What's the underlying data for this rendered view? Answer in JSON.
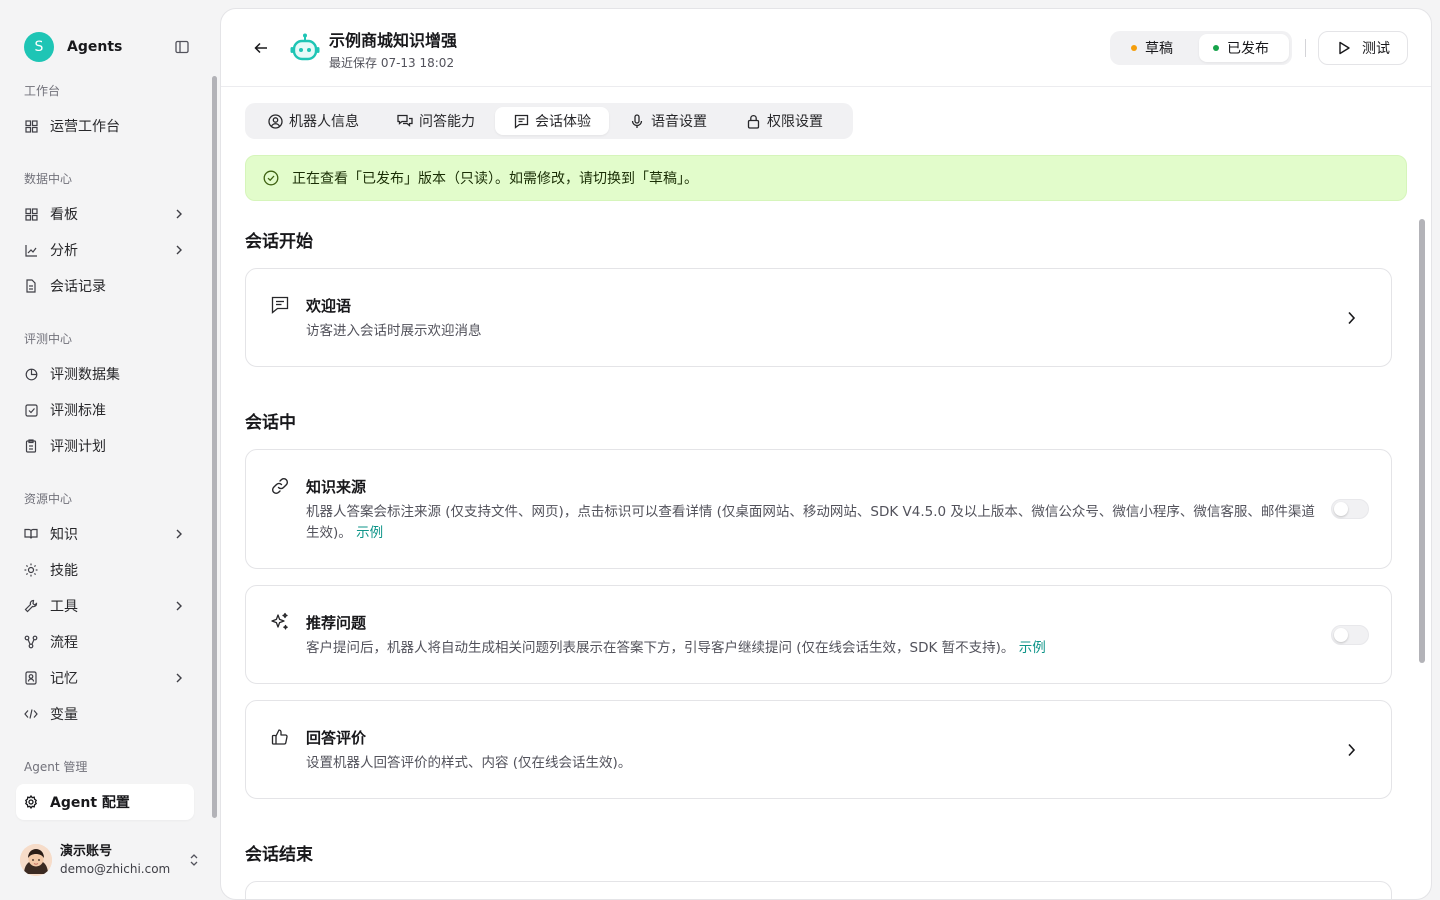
{
  "brand": {
    "logo_letter": "S",
    "name": "Agents"
  },
  "sidebar": {
    "groups": [
      {
        "label": "工作台",
        "items": [
          {
            "label": "运营工作台",
            "icon": "dashboard-icon",
            "chevron": false
          }
        ]
      },
      {
        "label": "数据中心",
        "items": [
          {
            "label": "看板",
            "icon": "board-icon",
            "chevron": true
          },
          {
            "label": "分析",
            "icon": "chart-line-icon",
            "chevron": true
          },
          {
            "label": "会话记录",
            "icon": "file-text-icon",
            "chevron": false
          }
        ]
      },
      {
        "label": "评测中心",
        "items": [
          {
            "label": "评测数据集",
            "icon": "pie-chart-icon",
            "chevron": false
          },
          {
            "label": "评测标准",
            "icon": "check-square-icon",
            "chevron": false
          },
          {
            "label": "评测计划",
            "icon": "clipboard-icon",
            "chevron": false
          }
        ]
      },
      {
        "label": "资源中心",
        "items": [
          {
            "label": "知识",
            "icon": "book-icon",
            "chevron": true
          },
          {
            "label": "技能",
            "icon": "sun-icon",
            "chevron": false
          },
          {
            "label": "工具",
            "icon": "wrench-icon",
            "chevron": true
          },
          {
            "label": "流程",
            "icon": "workflow-icon",
            "chevron": false
          },
          {
            "label": "记忆",
            "icon": "memory-icon",
            "chevron": true
          },
          {
            "label": "变量",
            "icon": "code-icon",
            "chevron": false
          }
        ]
      },
      {
        "label": "Agent 管理",
        "items": [
          {
            "label": "Agent 配置",
            "icon": "gear-icon",
            "chevron": false,
            "active": true
          }
        ]
      }
    ]
  },
  "user": {
    "name": "演示账号",
    "email": "demo@zhichi.com"
  },
  "header": {
    "title": "示例商城知识增强",
    "saved": "最近保存 07-13 18:02",
    "version_draft": "草稿",
    "version_published": "已发布",
    "test_label": "测试"
  },
  "tabs": [
    {
      "label": "机器人信息",
      "icon": "user-circle-icon"
    },
    {
      "label": "问答能力",
      "icon": "chat-bubbles-icon"
    },
    {
      "label": "会话体验",
      "icon": "message-square-icon",
      "active": true
    },
    {
      "label": "语音设置",
      "icon": "microphone-icon"
    },
    {
      "label": "权限设置",
      "icon": "lock-icon"
    }
  ],
  "notice": "正在查看「已发布」版本（只读）。如需修改，请切换到「草稿」。",
  "sections": {
    "start": "会话开始",
    "during": "会话中",
    "end": "会话结束"
  },
  "cards": {
    "welcome": {
      "title": "欢迎语",
      "desc": "访客进入会话时展示欢迎消息"
    },
    "source": {
      "title": "知识来源",
      "desc": "机器人答案会标注来源 (仅支持文件、网页)，点击标识可以查看详情 (仅桌面网站、移动网站、SDK V4.5.0 及以上版本、微信公众号、微信小程序、微信客服、邮件渠道生效)。",
      "link": "示例",
      "enabled": false
    },
    "suggest": {
      "title": "推荐问题",
      "desc": "客户提问后，机器人将自动生成相关问题列表展示在答案下方，引导客户继续提问 (仅在线会话生效，SDK 暂不支持)。",
      "link": "示例",
      "enabled": false
    },
    "rating": {
      "title": "回答评价",
      "desc": "设置机器人回答评价的样式、内容 (仅在线会话生效)。"
    }
  },
  "colors": {
    "accent": "#1ec5b5",
    "link": "#0d9488",
    "draft_dot": "#f59e0b",
    "published_dot": "#16a34a",
    "notice_bg": "#e2fccb"
  }
}
